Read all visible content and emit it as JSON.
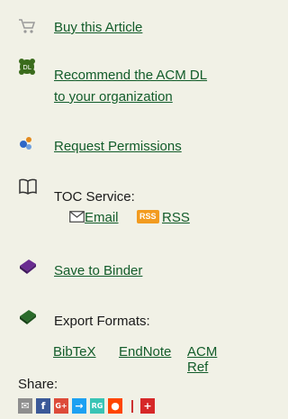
{
  "links": {
    "buy": "Buy this Article",
    "recommend_line1": "Recommend the ACM DL",
    "recommend_line2": "to your organization",
    "permissions": "Request Permissions",
    "toc_label": "TOC Service:",
    "email": "Email",
    "rss_badge": "RSS",
    "rss": "RSS",
    "binder": "Save to Binder",
    "export_label": "Export Formats:",
    "bibtex": "BibTeX",
    "endnote": "EndNote",
    "acmref": "ACM Ref"
  },
  "share": {
    "label": "Share:",
    "services": [
      {
        "name": "email-share-icon",
        "glyph": "✉",
        "color": "#8e8e8e"
      },
      {
        "name": "facebook-share-icon",
        "glyph": "f",
        "color": "#3b5998"
      },
      {
        "name": "googleplus-share-icon",
        "glyph": "G+",
        "color": "#dd4b39"
      },
      {
        "name": "twitter-share-icon",
        "glyph": "→",
        "color": "#1da1f2"
      },
      {
        "name": "researchgate-share-icon",
        "glyph": "RG",
        "color": "#39c4b5"
      },
      {
        "name": "reddit-share-icon",
        "glyph": "●",
        "color": "#ff4500"
      },
      {
        "name": "more-share-icon",
        "glyph": "+",
        "color": "#d62828"
      }
    ]
  },
  "colors": {
    "link": "#125c2a",
    "background": "#f1f1e6"
  }
}
